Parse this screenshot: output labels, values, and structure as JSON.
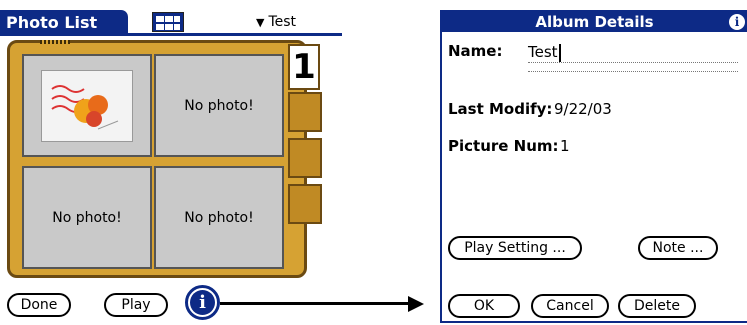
{
  "left": {
    "title": "Photo List",
    "album_name": "Test",
    "page_number": "1",
    "thumbs": [
      "",
      "No photo!",
      "No photo!",
      "No photo!"
    ],
    "buttons": {
      "done": "Done",
      "play": "Play",
      "info": "i"
    }
  },
  "right": {
    "title": "Album Details",
    "info": "i",
    "name_label": "Name:",
    "name_value": "Test",
    "last_modify_label": "Last Modify:",
    "last_modify_value": "9/22/03",
    "picture_num_label": "Picture Num:",
    "picture_num_value": "1",
    "buttons": {
      "play_setting": "Play Setting ...",
      "note": "Note ...",
      "ok": "OK",
      "cancel": "Cancel",
      "delete": "Delete"
    }
  },
  "colors": {
    "title_bar": "#0d2a86",
    "album_cover": "#d6a233",
    "thumb_bg": "#c9c9c9"
  },
  "icons": {
    "view_toggle": "grid-view-icon",
    "dropdown": "dropdown-arrow-icon",
    "info": "info-icon"
  }
}
